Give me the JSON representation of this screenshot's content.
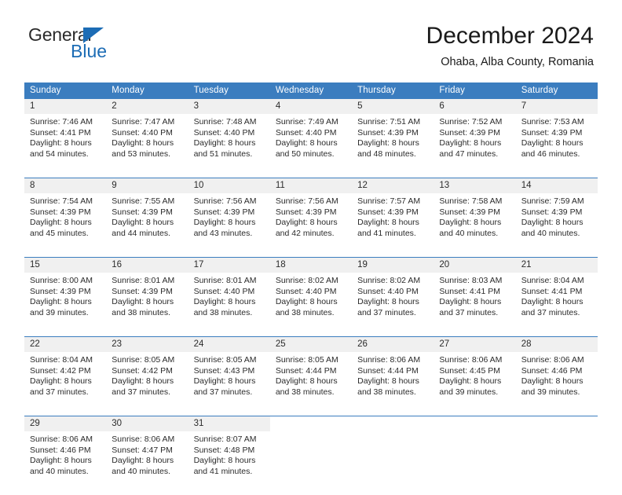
{
  "brand": {
    "name_top": "General",
    "name_bottom": "Blue",
    "accent_color": "#1c6cb5"
  },
  "header": {
    "title": "December 2024",
    "subtitle": "Ohaba, Alba County, Romania"
  },
  "theme": {
    "header_bg": "#3b7dbf",
    "header_text": "#ffffff",
    "daynum_bg": "#f0f0f0",
    "body_text": "#2b2b2b",
    "week_separator": "#3b7dbf"
  },
  "calendar": {
    "weekday_headers": [
      "Sunday",
      "Monday",
      "Tuesday",
      "Wednesday",
      "Thursday",
      "Friday",
      "Saturday"
    ],
    "labels": {
      "sunrise": "Sunrise:",
      "sunset": "Sunset:",
      "daylight": "Daylight:"
    },
    "weeks": [
      [
        {
          "day": "1",
          "sunrise": "Sunrise: 7:46 AM",
          "sunset": "Sunset: 4:41 PM",
          "daylight_1": "Daylight: 8 hours",
          "daylight_2": "and 54 minutes."
        },
        {
          "day": "2",
          "sunrise": "Sunrise: 7:47 AM",
          "sunset": "Sunset: 4:40 PM",
          "daylight_1": "Daylight: 8 hours",
          "daylight_2": "and 53 minutes."
        },
        {
          "day": "3",
          "sunrise": "Sunrise: 7:48 AM",
          "sunset": "Sunset: 4:40 PM",
          "daylight_1": "Daylight: 8 hours",
          "daylight_2": "and 51 minutes."
        },
        {
          "day": "4",
          "sunrise": "Sunrise: 7:49 AM",
          "sunset": "Sunset: 4:40 PM",
          "daylight_1": "Daylight: 8 hours",
          "daylight_2": "and 50 minutes."
        },
        {
          "day": "5",
          "sunrise": "Sunrise: 7:51 AM",
          "sunset": "Sunset: 4:39 PM",
          "daylight_1": "Daylight: 8 hours",
          "daylight_2": "and 48 minutes."
        },
        {
          "day": "6",
          "sunrise": "Sunrise: 7:52 AM",
          "sunset": "Sunset: 4:39 PM",
          "daylight_1": "Daylight: 8 hours",
          "daylight_2": "and 47 minutes."
        },
        {
          "day": "7",
          "sunrise": "Sunrise: 7:53 AM",
          "sunset": "Sunset: 4:39 PM",
          "daylight_1": "Daylight: 8 hours",
          "daylight_2": "and 46 minutes."
        }
      ],
      [
        {
          "day": "8",
          "sunrise": "Sunrise: 7:54 AM",
          "sunset": "Sunset: 4:39 PM",
          "daylight_1": "Daylight: 8 hours",
          "daylight_2": "and 45 minutes."
        },
        {
          "day": "9",
          "sunrise": "Sunrise: 7:55 AM",
          "sunset": "Sunset: 4:39 PM",
          "daylight_1": "Daylight: 8 hours",
          "daylight_2": "and 44 minutes."
        },
        {
          "day": "10",
          "sunrise": "Sunrise: 7:56 AM",
          "sunset": "Sunset: 4:39 PM",
          "daylight_1": "Daylight: 8 hours",
          "daylight_2": "and 43 minutes."
        },
        {
          "day": "11",
          "sunrise": "Sunrise: 7:56 AM",
          "sunset": "Sunset: 4:39 PM",
          "daylight_1": "Daylight: 8 hours",
          "daylight_2": "and 42 minutes."
        },
        {
          "day": "12",
          "sunrise": "Sunrise: 7:57 AM",
          "sunset": "Sunset: 4:39 PM",
          "daylight_1": "Daylight: 8 hours",
          "daylight_2": "and 41 minutes."
        },
        {
          "day": "13",
          "sunrise": "Sunrise: 7:58 AM",
          "sunset": "Sunset: 4:39 PM",
          "daylight_1": "Daylight: 8 hours",
          "daylight_2": "and 40 minutes."
        },
        {
          "day": "14",
          "sunrise": "Sunrise: 7:59 AM",
          "sunset": "Sunset: 4:39 PM",
          "daylight_1": "Daylight: 8 hours",
          "daylight_2": "and 40 minutes."
        }
      ],
      [
        {
          "day": "15",
          "sunrise": "Sunrise: 8:00 AM",
          "sunset": "Sunset: 4:39 PM",
          "daylight_1": "Daylight: 8 hours",
          "daylight_2": "and 39 minutes."
        },
        {
          "day": "16",
          "sunrise": "Sunrise: 8:01 AM",
          "sunset": "Sunset: 4:39 PM",
          "daylight_1": "Daylight: 8 hours",
          "daylight_2": "and 38 minutes."
        },
        {
          "day": "17",
          "sunrise": "Sunrise: 8:01 AM",
          "sunset": "Sunset: 4:40 PM",
          "daylight_1": "Daylight: 8 hours",
          "daylight_2": "and 38 minutes."
        },
        {
          "day": "18",
          "sunrise": "Sunrise: 8:02 AM",
          "sunset": "Sunset: 4:40 PM",
          "daylight_1": "Daylight: 8 hours",
          "daylight_2": "and 38 minutes."
        },
        {
          "day": "19",
          "sunrise": "Sunrise: 8:02 AM",
          "sunset": "Sunset: 4:40 PM",
          "daylight_1": "Daylight: 8 hours",
          "daylight_2": "and 37 minutes."
        },
        {
          "day": "20",
          "sunrise": "Sunrise: 8:03 AM",
          "sunset": "Sunset: 4:41 PM",
          "daylight_1": "Daylight: 8 hours",
          "daylight_2": "and 37 minutes."
        },
        {
          "day": "21",
          "sunrise": "Sunrise: 8:04 AM",
          "sunset": "Sunset: 4:41 PM",
          "daylight_1": "Daylight: 8 hours",
          "daylight_2": "and 37 minutes."
        }
      ],
      [
        {
          "day": "22",
          "sunrise": "Sunrise: 8:04 AM",
          "sunset": "Sunset: 4:42 PM",
          "daylight_1": "Daylight: 8 hours",
          "daylight_2": "and 37 minutes."
        },
        {
          "day": "23",
          "sunrise": "Sunrise: 8:05 AM",
          "sunset": "Sunset: 4:42 PM",
          "daylight_1": "Daylight: 8 hours",
          "daylight_2": "and 37 minutes."
        },
        {
          "day": "24",
          "sunrise": "Sunrise: 8:05 AM",
          "sunset": "Sunset: 4:43 PM",
          "daylight_1": "Daylight: 8 hours",
          "daylight_2": "and 37 minutes."
        },
        {
          "day": "25",
          "sunrise": "Sunrise: 8:05 AM",
          "sunset": "Sunset: 4:44 PM",
          "daylight_1": "Daylight: 8 hours",
          "daylight_2": "and 38 minutes."
        },
        {
          "day": "26",
          "sunrise": "Sunrise: 8:06 AM",
          "sunset": "Sunset: 4:44 PM",
          "daylight_1": "Daylight: 8 hours",
          "daylight_2": "and 38 minutes."
        },
        {
          "day": "27",
          "sunrise": "Sunrise: 8:06 AM",
          "sunset": "Sunset: 4:45 PM",
          "daylight_1": "Daylight: 8 hours",
          "daylight_2": "and 39 minutes."
        },
        {
          "day": "28",
          "sunrise": "Sunrise: 8:06 AM",
          "sunset": "Sunset: 4:46 PM",
          "daylight_1": "Daylight: 8 hours",
          "daylight_2": "and 39 minutes."
        }
      ],
      [
        {
          "day": "29",
          "sunrise": "Sunrise: 8:06 AM",
          "sunset": "Sunset: 4:46 PM",
          "daylight_1": "Daylight: 8 hours",
          "daylight_2": "and 40 minutes."
        },
        {
          "day": "30",
          "sunrise": "Sunrise: 8:06 AM",
          "sunset": "Sunset: 4:47 PM",
          "daylight_1": "Daylight: 8 hours",
          "daylight_2": "and 40 minutes."
        },
        {
          "day": "31",
          "sunrise": "Sunrise: 8:07 AM",
          "sunset": "Sunset: 4:48 PM",
          "daylight_1": "Daylight: 8 hours",
          "daylight_2": "and 41 minutes."
        },
        {
          "day": "",
          "sunrise": "",
          "sunset": "",
          "daylight_1": "",
          "daylight_2": ""
        },
        {
          "day": "",
          "sunrise": "",
          "sunset": "",
          "daylight_1": "",
          "daylight_2": ""
        },
        {
          "day": "",
          "sunrise": "",
          "sunset": "",
          "daylight_1": "",
          "daylight_2": ""
        },
        {
          "day": "",
          "sunrise": "",
          "sunset": "",
          "daylight_1": "",
          "daylight_2": ""
        }
      ]
    ]
  }
}
